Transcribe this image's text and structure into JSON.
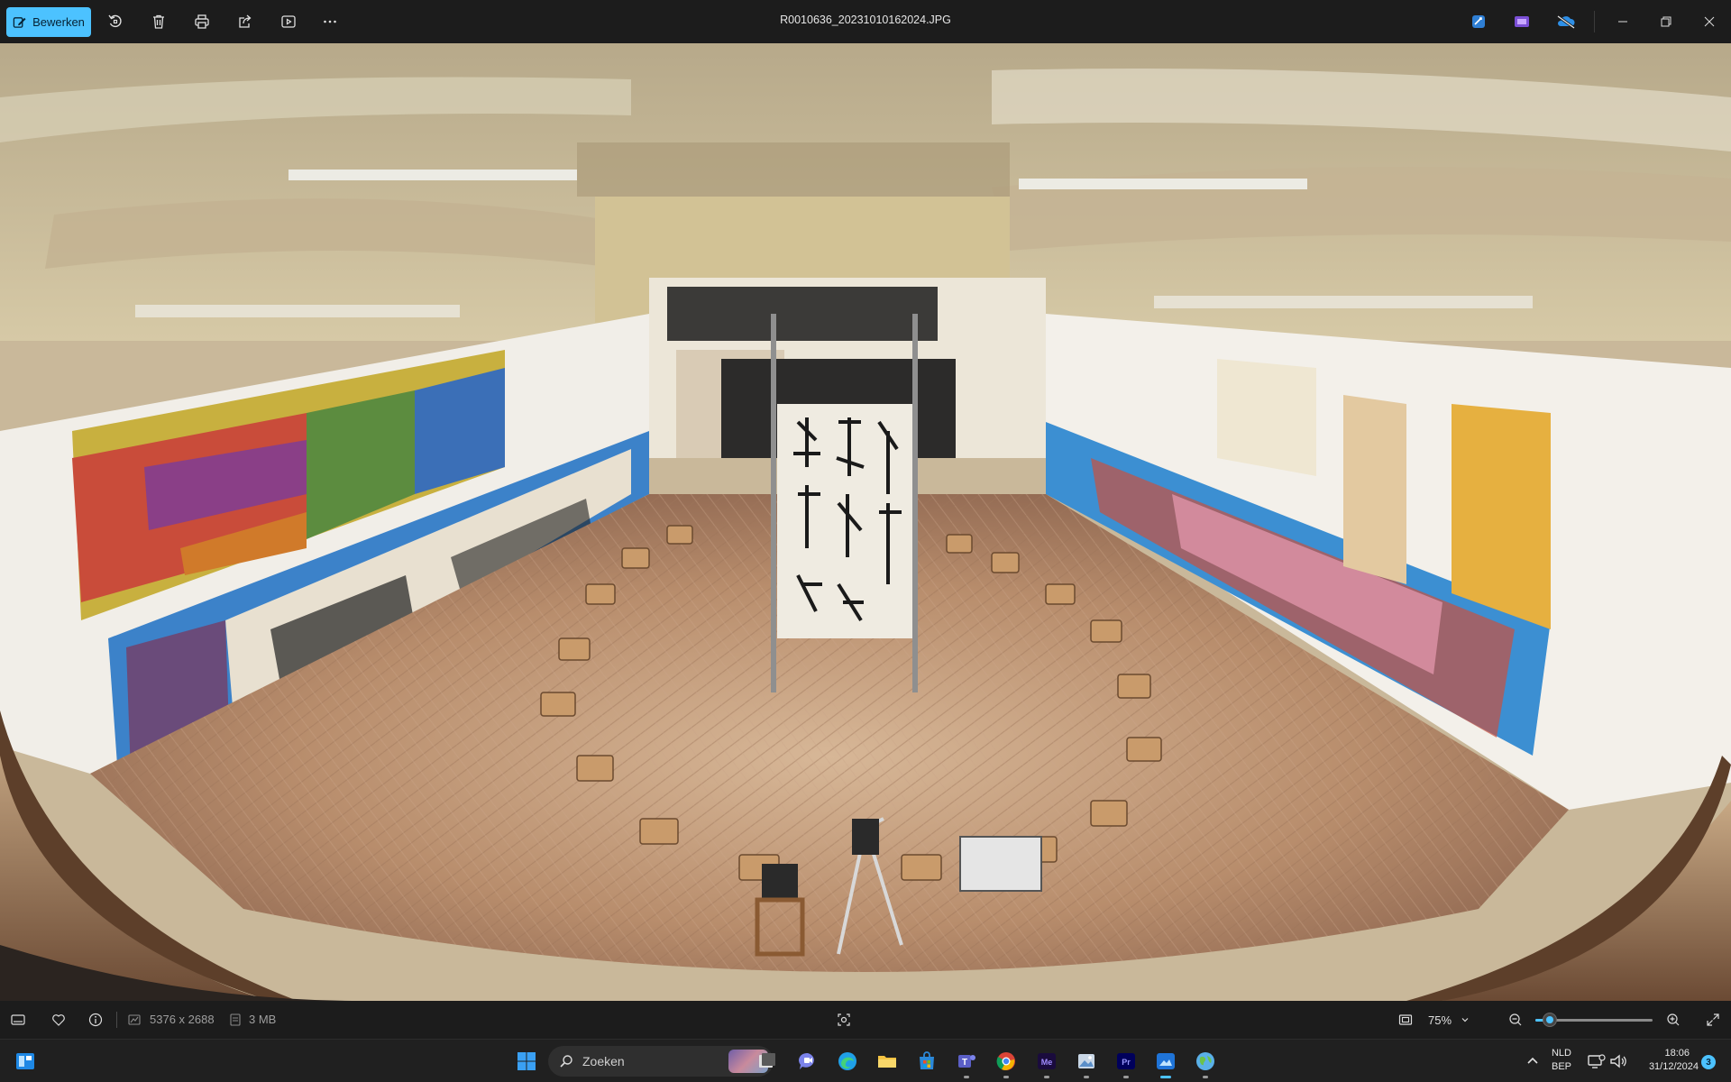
{
  "toolbar": {
    "edit_label": "Bewerken",
    "file_title": "R0010636_20231010162024.JPG",
    "icons": [
      "rotate-icon",
      "delete-icon",
      "print-icon",
      "share-icon",
      "slideshow-icon",
      "more-icon"
    ],
    "right_apps": [
      "clipchamp-icon",
      "designer-icon",
      "onedrive-off-icon"
    ],
    "window_controls": [
      "minimize-icon",
      "restore-icon",
      "close-icon"
    ]
  },
  "status": {
    "dimensions": "5376 x 2688",
    "file_size": "3 MB",
    "zoom_label": "75%",
    "zoom_level": 0.12
  },
  "taskbar": {
    "search_placeholder": "Zoeken",
    "lang_primary": "NLD",
    "lang_secondary": "BEP",
    "time": "18:06",
    "date": "31/12/2024",
    "notification_count": "3",
    "apps": [
      "start",
      "search",
      "task-view",
      "chat",
      "edge",
      "file-explorer",
      "store",
      "teams",
      "chrome",
      "media-encoder",
      "photos-app",
      "premiere",
      "photos-viewer",
      "maps"
    ]
  },
  "colors": {
    "accent": "#4cc2ff",
    "toolbar_bg": "#1c1c1c",
    "taskbar_bg": "#202020"
  }
}
